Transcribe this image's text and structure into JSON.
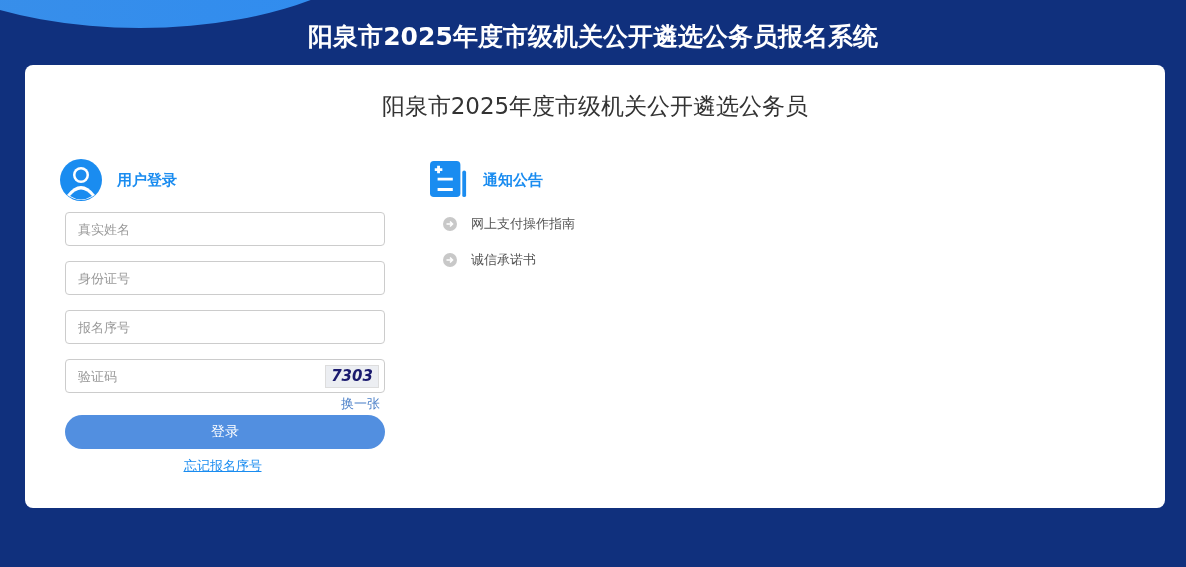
{
  "header": {
    "title": "阳泉市2025年度市级机关公开遴选公务员报名系统"
  },
  "card": {
    "title": "阳泉市2025年度市级机关公开遴选公务员"
  },
  "login": {
    "heading": "用户登录",
    "fields": [
      {
        "kind": "text",
        "placeholder": "真实姓名"
      },
      {
        "kind": "text",
        "placeholder": "身份证号"
      },
      {
        "kind": "text",
        "placeholder": "报名序号"
      },
      {
        "kind": "captcha",
        "placeholder": "验证码",
        "captcha": "7303",
        "refresh": "换一张"
      }
    ],
    "submit": "登录",
    "forgot": "忘记报名序号"
  },
  "notices": {
    "heading": "通知公告",
    "items": [
      "网上支付操作指南",
      "诚信承诺书"
    ]
  }
}
